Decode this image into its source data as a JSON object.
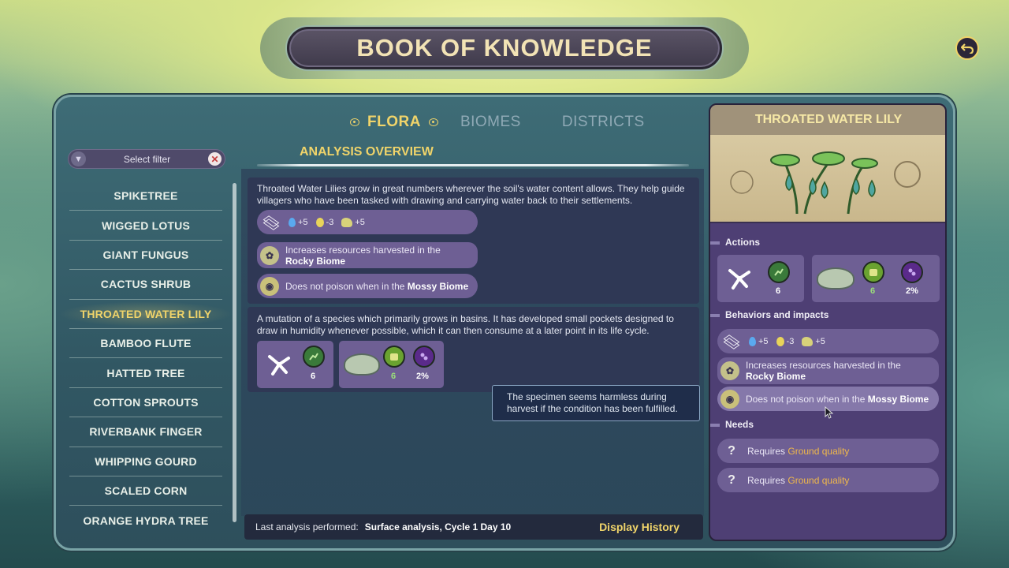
{
  "header": {
    "title": "BOOK OF KNOWLEDGE"
  },
  "tabs": [
    {
      "label": "FLORA",
      "active": true
    },
    {
      "label": "BIOMES",
      "active": false
    },
    {
      "label": "DISTRICTS",
      "active": false
    }
  ],
  "filter": {
    "label": "Select filter"
  },
  "plants": [
    "SPIKETREE",
    "WIGGED LOTUS",
    "GIANT FUNGUS",
    "CACTUS SHRUB",
    "THROATED WATER LILY",
    "BAMBOO FLUTE",
    "HATTED TREE",
    "COTTON SPROUTS",
    "RIVERBANK FINGER",
    "WHIPPING GOURD",
    "SCALED CORN",
    "ORANGE HYDRA TREE"
  ],
  "selected_plant": "THROATED WATER LILY",
  "overview": {
    "title": "ANALYSIS OVERVIEW",
    "description": "Throated Water Lilies grow in great numbers wherever the soil's water content allows. They help guide villagers who have been tasked with drawing and carrying water back to their settlements.",
    "stats": [
      {
        "icon": "water-drop-icon",
        "value": "+5"
      },
      {
        "icon": "seed-icon",
        "value": "-3"
      },
      {
        "icon": "sprout-icon",
        "value": "+5"
      }
    ],
    "behavior_1_pre": "Increases resources harvested in the ",
    "behavior_1_bold": "Rocky Biome",
    "behavior_2_pre": "Does not poison when in the ",
    "behavior_2_bold": "Mossy Biome",
    "mutation_text": "A mutation of a species which primarily grows in basins. It has developed small pockets designed to draw in humidity whenever possible, which it can then consume at a later point in its life cycle.",
    "action_1_count": "6",
    "action_2_count": "6",
    "action_2_pct": "2%"
  },
  "tooltip": {
    "text": "The specimen seems harmless during harvest if the condition has been fulfilled."
  },
  "footer": {
    "label": "Last analysis performed:",
    "value": "Surface analysis, Cycle 1 Day 10",
    "history": "Display History"
  },
  "detail": {
    "title": "THROATED WATER LILY",
    "actions_label": "Actions",
    "behaviors_label": "Behaviors and impacts",
    "needs_label": "Needs",
    "needs": [
      {
        "pre": "Requires ",
        "highlight": "Ground quality"
      },
      {
        "pre": "Requires ",
        "highlight": "Ground quality"
      }
    ]
  },
  "colors": {
    "accent": "#f0d46a",
    "panel": "#4e3f74",
    "pill": "#6e5f94"
  }
}
